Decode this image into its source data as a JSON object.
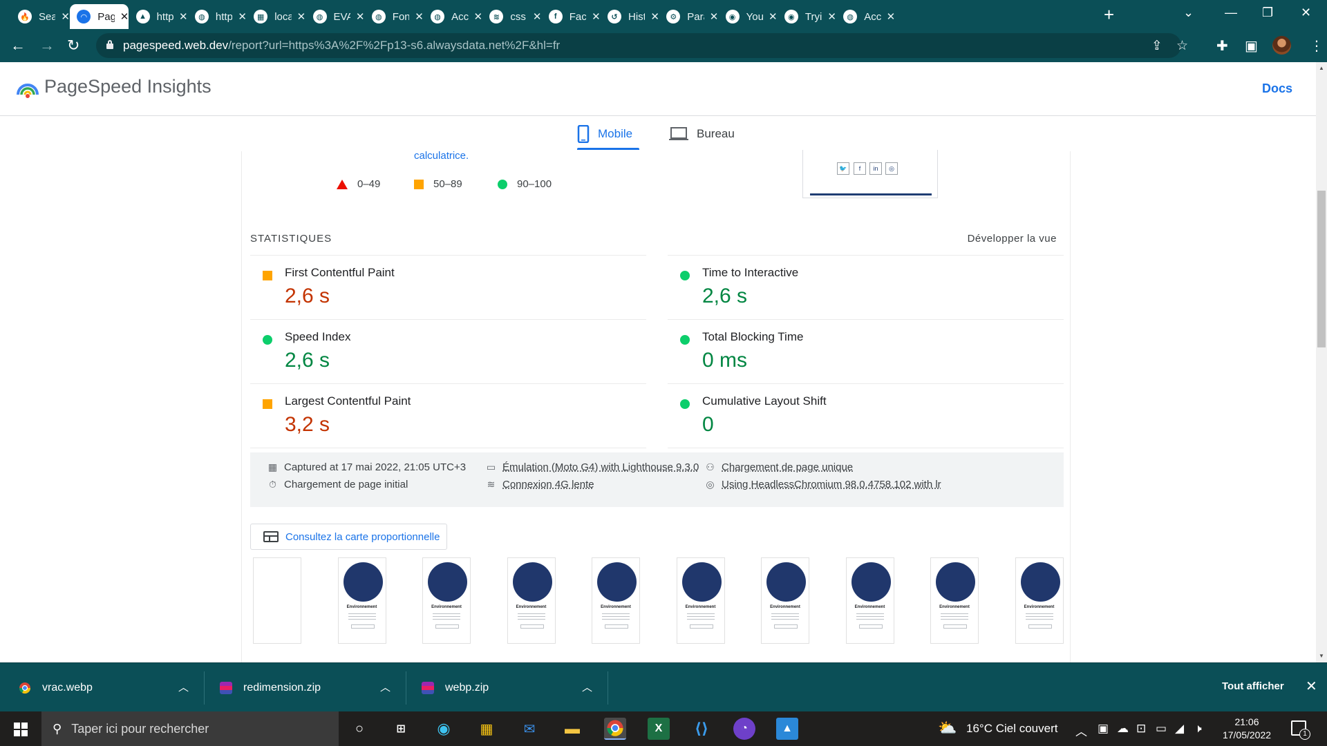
{
  "browser": {
    "tabs": [
      {
        "title": "Sea",
        "icon": "flame-icon",
        "color": "#ff5722"
      },
      {
        "title": "Pag",
        "icon": "pagespeed-icon",
        "active": true
      },
      {
        "title": "http",
        "icon": "cone-icon"
      },
      {
        "title": "http",
        "icon": "globe-icon"
      },
      {
        "title": "loca",
        "icon": "image-icon"
      },
      {
        "title": "EVA",
        "icon": "globe-icon"
      },
      {
        "title": "Fon",
        "icon": "globe-icon"
      },
      {
        "title": "Acc",
        "icon": "globe-icon"
      },
      {
        "title": "css",
        "icon": "stack-icon"
      },
      {
        "title": "Face",
        "icon": "facebook-icon"
      },
      {
        "title": "Hist",
        "icon": "history-icon"
      },
      {
        "title": "Para",
        "icon": "gear-icon"
      },
      {
        "title": "You",
        "icon": "github-icon"
      },
      {
        "title": "Tryi",
        "icon": "github-icon"
      },
      {
        "title": "Acc",
        "icon": "globe-icon"
      }
    ],
    "url_host": "pagespeed.web.dev",
    "url_rest": "/report?url=https%3A%2F%2Fp13-s6.alwaysdata.net%2F&hl=fr"
  },
  "header": {
    "title": "PageSpeed Insights",
    "docs": "Docs"
  },
  "device_tabs": {
    "mobile": "Mobile",
    "desktop": "Bureau"
  },
  "report": {
    "calc_link": "calculatrice.",
    "legend": [
      {
        "range": "0–49",
        "shape": "triangle",
        "color": "#eb0f00"
      },
      {
        "range": "50–89",
        "shape": "square",
        "color": "#ffa400"
      },
      {
        "range": "90–100",
        "shape": "circle",
        "color": "#0cce6b"
      }
    ],
    "stats_title": "STATISTIQUES",
    "expand": "Développer la vue",
    "metrics": [
      {
        "name": "First Contentful Paint",
        "value": "2,6 s",
        "rating": "average"
      },
      {
        "name": "Time to Interactive",
        "value": "2,6 s",
        "rating": "good"
      },
      {
        "name": "Speed Index",
        "value": "2,6 s",
        "rating": "good"
      },
      {
        "name": "Total Blocking Time",
        "value": "0 ms",
        "rating": "good"
      },
      {
        "name": "Largest Contentful Paint",
        "value": "3,2 s",
        "rating": "average"
      },
      {
        "name": "Cumulative Layout Shift",
        "value": "0",
        "rating": "good"
      }
    ],
    "runinfo": {
      "captured": "Captured at 17 mai 2022, 21:05 UTC+3",
      "initial": "Chargement de page initial",
      "emulation": "Émulation (Moto G4) with Lighthouse 9.3.0",
      "connection": "Connexion 4G lente",
      "single": "Chargement de page unique",
      "chromium": "Using HeadlessChromium 98.0.4758.102 with lr"
    },
    "treemap": "Consultez la carte proportionnelle",
    "frame_title": "Environnement"
  },
  "downloads": {
    "items": [
      {
        "name": "vrac.webp",
        "icon": "chrome-icon"
      },
      {
        "name": "redimension.zip",
        "icon": "archive-icon"
      },
      {
        "name": "webp.zip",
        "icon": "archive-icon"
      }
    ],
    "show_all": "Tout afficher"
  },
  "taskbar": {
    "search_placeholder": "Taper ici pour rechercher",
    "weather": "16°C  Ciel couvert",
    "time": "21:06",
    "date": "17/05/2022",
    "notifications": "1"
  }
}
